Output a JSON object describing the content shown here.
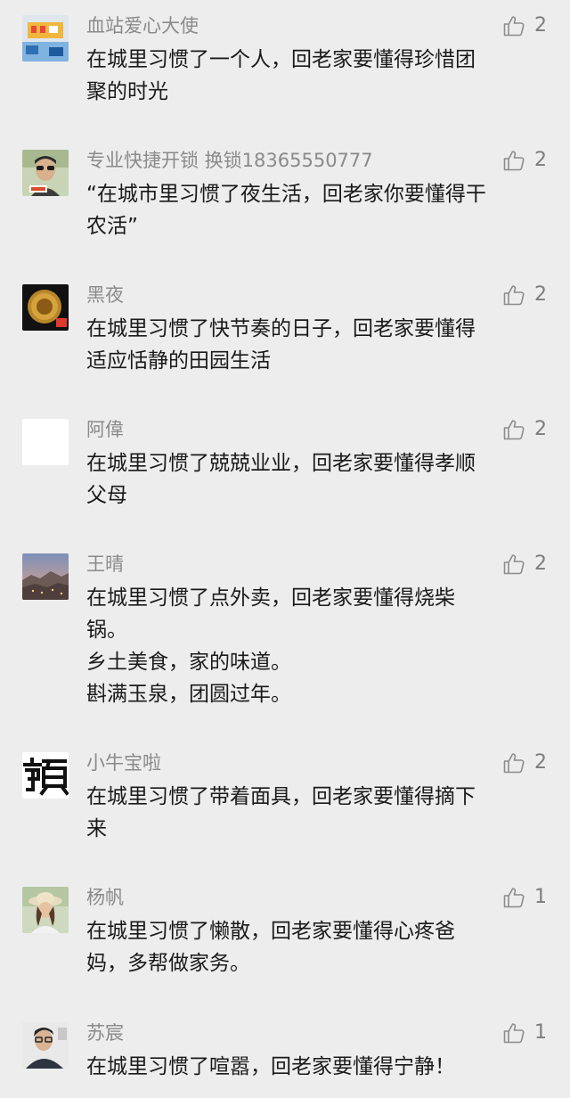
{
  "comments": [
    {
      "name": "血站爱心大使",
      "text": "在城里习惯了一个人，回老家要懂得珍惜团\n聚的时光",
      "likes": "2",
      "avatar_icon": "blood-station-photo"
    },
    {
      "name": "专业快捷开锁   换锁18365550777",
      "text": "“在城市里习惯了夜生活，回老家你要懂得干\n农活”",
      "likes": "2",
      "avatar_icon": "man-sunglasses-photo"
    },
    {
      "name": "黑夜",
      "text": "在城里习惯了快节奏的日子，回老家要懂得\n适应恬静的田园生活",
      "likes": "2",
      "avatar_icon": "gold-coin-photo"
    },
    {
      "name": "阿偉",
      "text": "在城里习惯了兢兢业业，回老家要懂得孝顺\n父母",
      "likes": "2",
      "avatar_icon": "blank-white-avatar"
    },
    {
      "name": "王晴",
      "text": "在城里习惯了点外卖，回老家要懂得烧柴\n锅。\n乡土美食，家的味道。\n斟满玉泉，团圆过年。",
      "likes": "2",
      "avatar_icon": "sunset-town-photo"
    },
    {
      "name": "小牛宝啦",
      "text": "在城里习惯了带着面具，回老家要懂得摘下\n来",
      "likes": "2",
      "avatar_icon": "calligraphy-logo"
    },
    {
      "name": "杨帆",
      "text": "在城里习惯了懒散，回老家要懂得心疼爸\n妈，多帮做家务。",
      "likes": "1",
      "avatar_icon": "woman-hat-photo"
    },
    {
      "name": "苏宸",
      "text": "在城里习惯了喧嚣，回老家要懂得宁静！",
      "likes": "1",
      "avatar_icon": "man-glasses-photo"
    }
  ],
  "colors": {
    "background": "#ededed",
    "name_text": "#8a8a8a",
    "body_text": "#1a1a1a",
    "like_icon": "#8c8c8c"
  }
}
